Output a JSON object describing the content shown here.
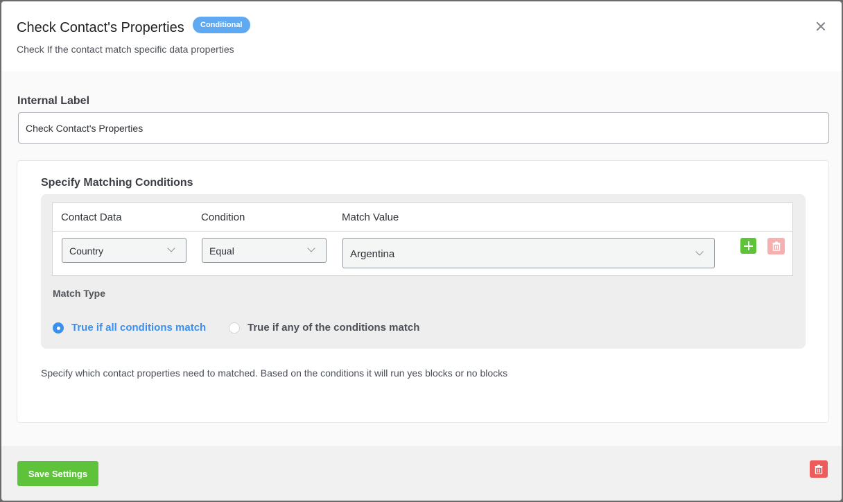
{
  "header": {
    "title": "Check Contact's Properties",
    "badge": "Conditional",
    "subtitle": "Check If the contact match specific data properties"
  },
  "internal_label": {
    "heading": "Internal Label",
    "value": "Check Contact's Properties"
  },
  "conditions": {
    "heading": "Specify Matching Conditions",
    "columns": [
      "Contact Data",
      "Condition",
      "Match Value"
    ],
    "rows": [
      {
        "contact_data": "Country",
        "condition": "Equal",
        "match_value": "Argentina"
      }
    ],
    "match_type": {
      "label": "Match Type",
      "options": [
        "True if all conditions match",
        "True if any of the conditions match"
      ],
      "selected": "True if all conditions match"
    },
    "help_text": "Specify which contact properties need to matched. Based on the conditions it will run yes blocks or no blocks"
  },
  "footer": {
    "save_label": "Save Settings"
  },
  "colors": {
    "primary_green": "#5ec23b",
    "accent_blue": "#3b8fef",
    "badge_blue": "#5fa9f3",
    "danger_red": "#ed5b5b"
  },
  "icons": [
    "close-icon",
    "chevron-down-icon",
    "plus-icon",
    "trash-icon",
    "radio-selected-icon",
    "radio-unselected-icon"
  ]
}
